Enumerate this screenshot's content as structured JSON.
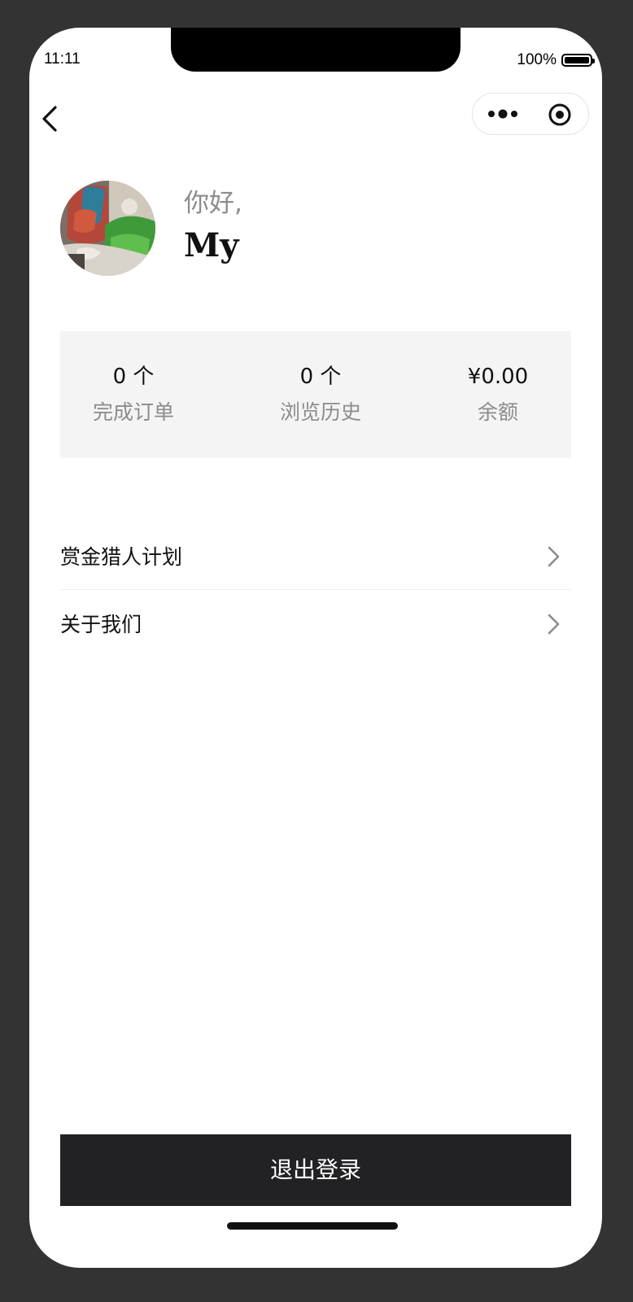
{
  "status_bar": {
    "time": "11:11",
    "battery": "100%"
  },
  "profile": {
    "greeting": "你好,",
    "name": "My"
  },
  "stats": [
    {
      "value": "0 个",
      "label": "完成订单"
    },
    {
      "value": "0 个",
      "label": "浏览历史"
    },
    {
      "value": "¥0.00",
      "label": "余额"
    }
  ],
  "menu": [
    {
      "label": "赏金猎人计划"
    },
    {
      "label": "关于我们"
    }
  ],
  "logout_label": "退出登录"
}
